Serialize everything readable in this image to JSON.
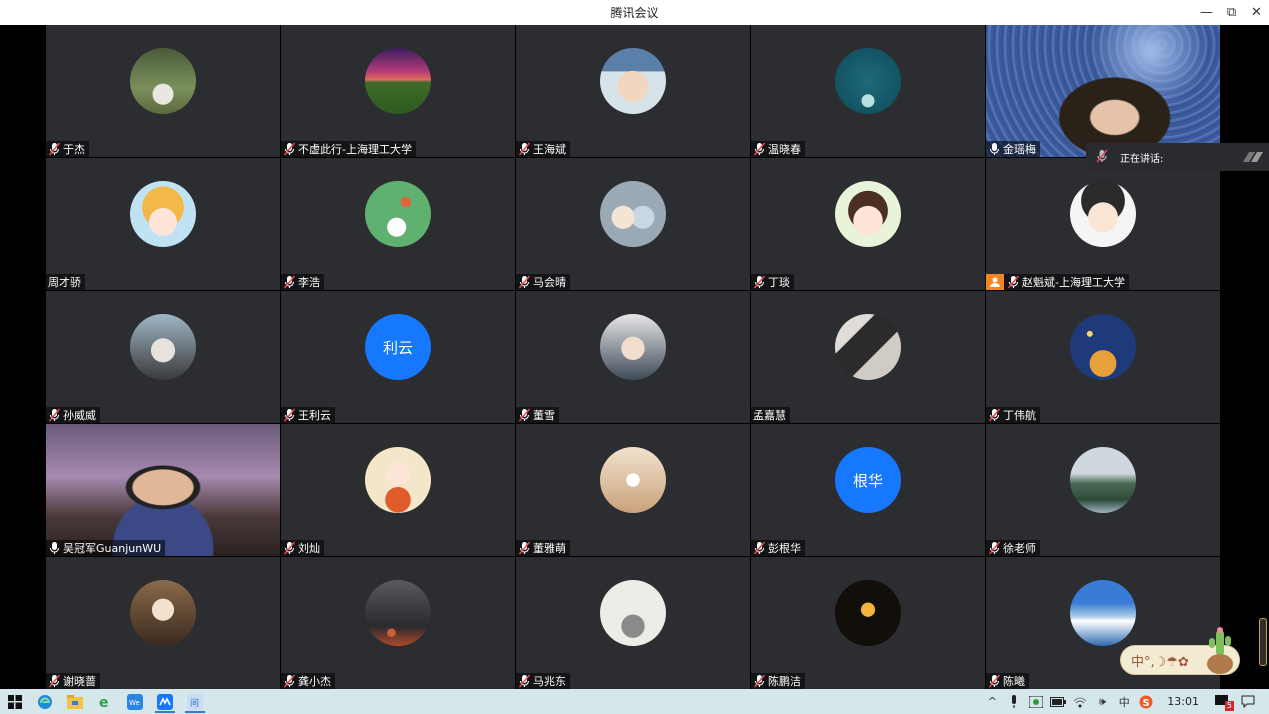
{
  "window": {
    "title": "腾讯会议",
    "minimize": "—",
    "restore": "⧉",
    "close": "✕"
  },
  "speaking_label": "正在讲话:",
  "participants": [
    {
      "name": "于杰",
      "mic": "muted",
      "avatar": "photo-outdoor"
    },
    {
      "name": "不虚此行-上海理工大学",
      "mic": "muted",
      "avatar": "photo-sunset"
    },
    {
      "name": "王海斌",
      "mic": "muted",
      "avatar": "photo-child"
    },
    {
      "name": "温晓春",
      "mic": "muted",
      "avatar": "photo-teal"
    },
    {
      "name": "金瑶梅",
      "mic": "on",
      "avatar": "video"
    },
    {
      "name": "周才骄",
      "mic": "none",
      "avatar": "cartoon-girl-hat"
    },
    {
      "name": "李浩",
      "mic": "muted",
      "avatar": "basketball-green"
    },
    {
      "name": "马会晴",
      "mic": "muted",
      "avatar": "plush-toys"
    },
    {
      "name": "丁琰",
      "mic": "muted",
      "avatar": "cartoon-chick"
    },
    {
      "name": "赵魁斌-上海理工大学",
      "mic": "muted",
      "avatar": "cartoon-man",
      "host": true
    },
    {
      "name": "孙威威",
      "mic": "muted",
      "avatar": "photo-mask"
    },
    {
      "name": "王利云",
      "mic": "muted",
      "avatar": "text",
      "initials": "利云"
    },
    {
      "name": "董雪",
      "mic": "muted",
      "avatar": "photo-woman"
    },
    {
      "name": "孟嘉慧",
      "mic": "none",
      "avatar": "photo-dark"
    },
    {
      "name": "丁伟航",
      "mic": "muted",
      "avatar": "little-prince"
    },
    {
      "name": "吴冠军GuanjunWU",
      "mic": "on",
      "avatar": "video"
    },
    {
      "name": "刘灿",
      "mic": "muted",
      "avatar": "cartoon-boy-bike"
    },
    {
      "name": "董雅萌",
      "mic": "muted",
      "avatar": "photo-warm"
    },
    {
      "name": "彭根华",
      "mic": "muted",
      "avatar": "text",
      "initials": "根华"
    },
    {
      "name": "徐老师",
      "mic": "muted",
      "avatar": "photo-mountain"
    },
    {
      "name": "谢晓蔷",
      "mic": "muted",
      "avatar": "photo-girl-brown"
    },
    {
      "name": "龚小杰",
      "mic": "muted",
      "avatar": "photo-storm"
    },
    {
      "name": "马兆东",
      "mic": "muted",
      "avatar": "photo-silhouettes"
    },
    {
      "name": "陈鹏洁",
      "mic": "muted",
      "avatar": "photo-lantern"
    },
    {
      "name": "陈曦",
      "mic": "muted",
      "avatar": "photo-sky"
    }
  ],
  "ime": {
    "text": "中°,☽☂✿"
  },
  "taskbar": {
    "apps": [
      "start",
      "edge",
      "file-explorer",
      "ie",
      "wecom",
      "tencent-meeting",
      "app-blue"
    ],
    "tray": {
      "chevron": "^",
      "ime_lang": "中",
      "volume": "🕪",
      "time": "13:01",
      "notification_count": "5"
    }
  },
  "colors": {
    "accent_blue": "#1677ff",
    "tile_bg": "#2c2d31",
    "taskbar_bg": "#d6e7ec",
    "host_orange": "#f7841f"
  }
}
